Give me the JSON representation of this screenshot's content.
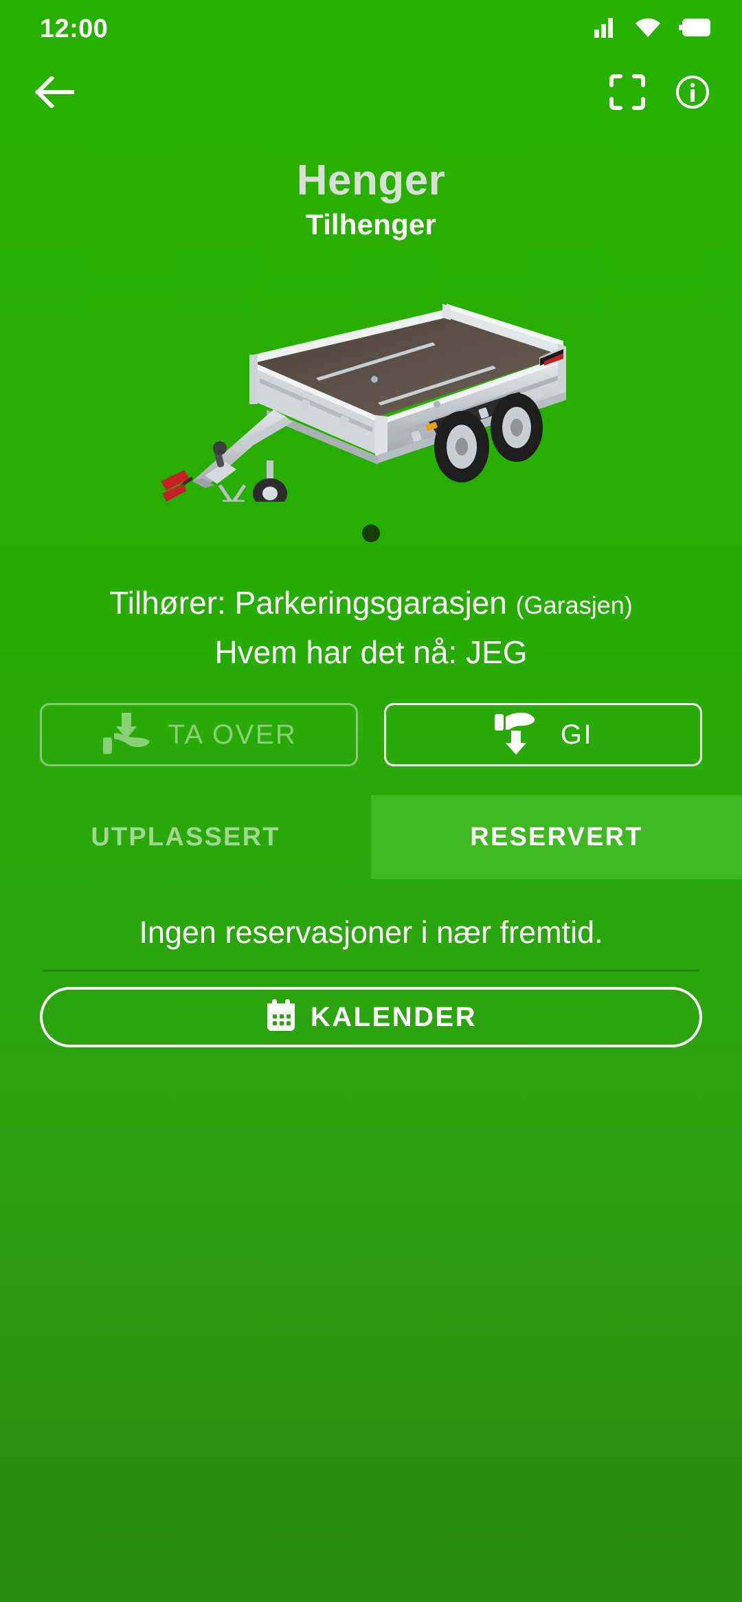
{
  "status_bar": {
    "time": "12:00",
    "icons": [
      "signal-icon",
      "wifi-icon",
      "battery-icon"
    ]
  },
  "top_nav": {
    "back_icon": "back-arrow-icon",
    "scan_icon": "qr-scan-frame-icon",
    "info_icon": "info-circle-icon"
  },
  "header": {
    "title": "Henger",
    "subtitle": "Tilhenger"
  },
  "carousel": {
    "image_alt": "trailer-photo",
    "dot_count": 1,
    "active_dot": 0
  },
  "details": {
    "owner_label": "Tilhører: Parkeringsgarasjen",
    "owner_group": "(Garasjen)",
    "holder_line": "Hvem har det nå: JEG"
  },
  "actions": [
    {
      "label": "TA OVER",
      "icon": "hand-receive-down-arrow-icon",
      "enabled": false
    },
    {
      "label": "GI",
      "icon": "hand-give-down-arrow-icon",
      "enabled": true
    }
  ],
  "tabs": [
    {
      "label": "UTPLASSERT",
      "active": false
    },
    {
      "label": "RESERVERT",
      "active": true
    }
  ],
  "reservations": {
    "empty_text": "Ingen reservasjoner i nær fremtid.",
    "calendar_button": "KALENDER",
    "calendar_icon": "calendar-icon"
  },
  "colors": {
    "background_top": "#28b000",
    "background_bottom": "#288c10",
    "active_tab": "#3fb822",
    "title_dim": "#d7dfd6",
    "text_on_green": "#ffffff",
    "dot_active": "#143f08"
  }
}
